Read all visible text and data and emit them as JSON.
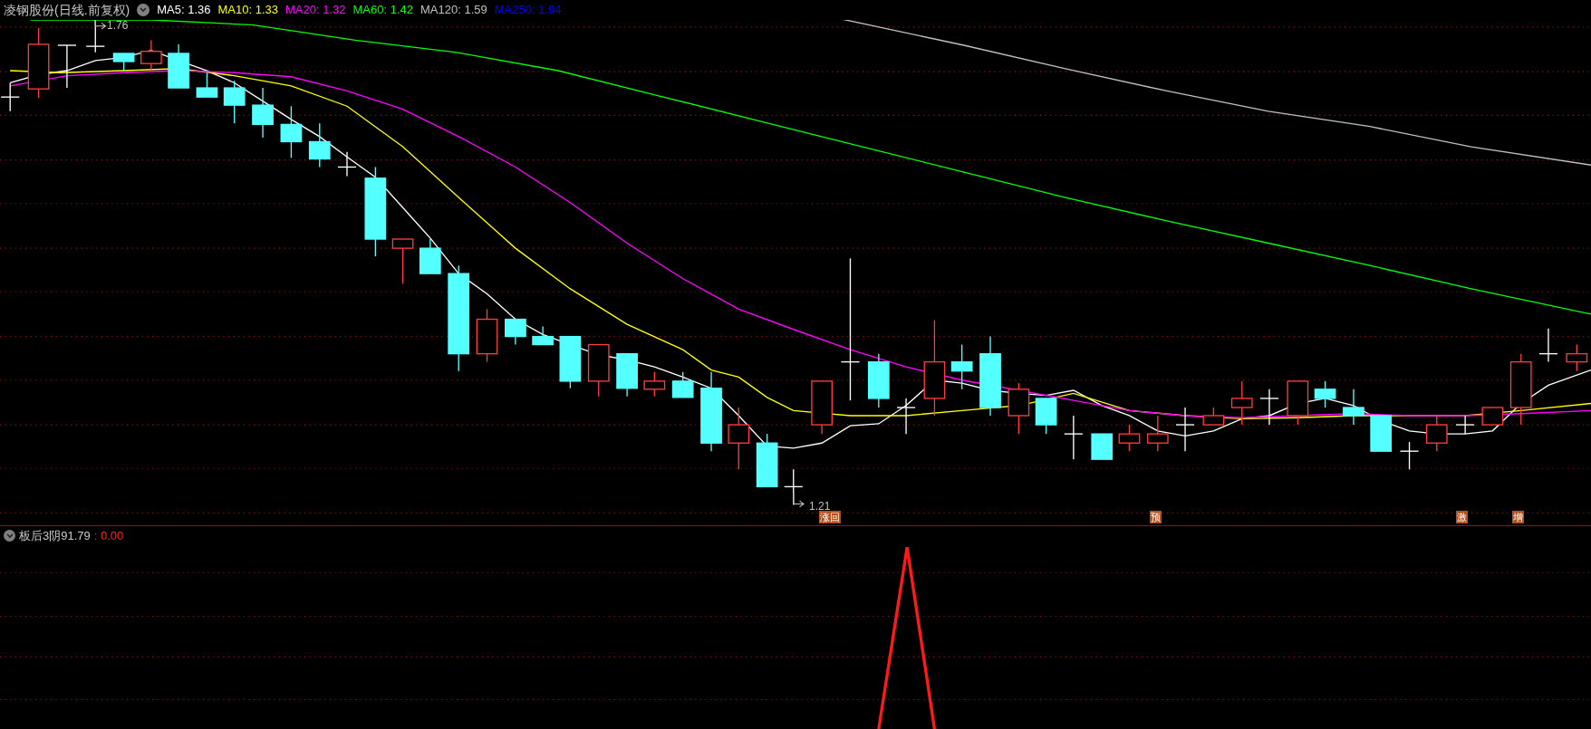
{
  "legend": {
    "title": "凌钢股份(日线.前复权)",
    "items": [
      {
        "label": "MA5: 1.36",
        "color": "#ffffff"
      },
      {
        "label": "MA10: 1.33",
        "color": "#ffff00"
      },
      {
        "label": "MA20: 1.32",
        "color": "#ff00ff"
      },
      {
        "label": "MA60: 1.42",
        "color": "#00ff00"
      },
      {
        "label": "MA120: 1.59",
        "color": "#c0c0c0"
      },
      {
        "label": "MA250: 1.94",
        "color": "#0000ff"
      }
    ]
  },
  "price_chart": {
    "high_label": "1.76",
    "low_label": "1.21",
    "signals": [
      "涨回",
      "预",
      "激",
      "增"
    ]
  },
  "indicator": {
    "name": "板后3阴",
    "param": "91.79",
    "value": ": 0.00"
  }
}
